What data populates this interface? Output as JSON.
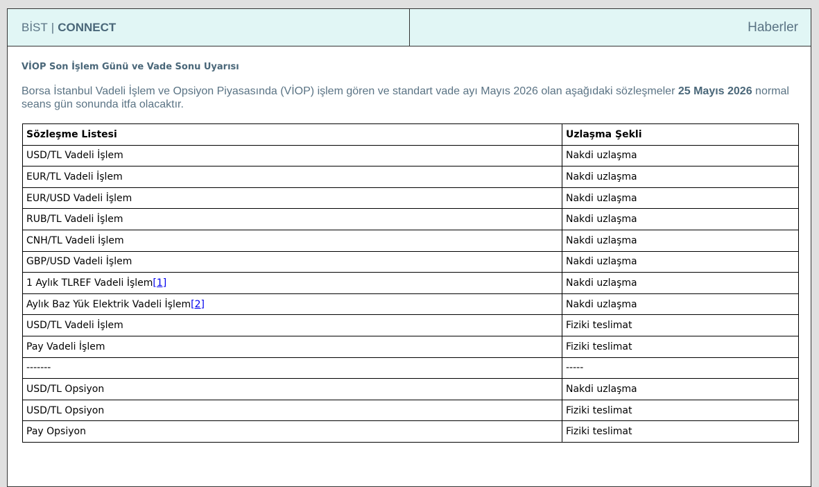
{
  "header": {
    "brand_bist": "BİST",
    "brand_separator": "|",
    "brand_connect": "CONNECT",
    "news_link": "Haberler"
  },
  "notice": {
    "title": "VİOP Son İşlem Günü ve Vade Sonu Uyarısı",
    "body_before": "Borsa İstanbul Vadeli İşlem ve Opsiyon Piyasasında (VİOP) işlem gören ve standart vade ayı Mayıs 2026 olan aşağıdaki sözleşmeler ",
    "body_date": "25 Mayıs 2026",
    "body_after": " normal seans gün sonunda itfa olacaktır."
  },
  "table": {
    "headers": [
      "Sözleşme Listesi",
      "Uzlaşma Şekli"
    ],
    "rows": [
      {
        "contract": "USD/TL Vadeli İşlem",
        "footnote": "",
        "settlement": "Nakdi uzlaşma"
      },
      {
        "contract": "EUR/TL Vadeli İşlem",
        "footnote": "",
        "settlement": "Nakdi uzlaşma"
      },
      {
        "contract": "EUR/USD Vadeli İşlem",
        "footnote": "",
        "settlement": "Nakdi uzlaşma"
      },
      {
        "contract": "RUB/TL Vadeli İşlem",
        "footnote": "",
        "settlement": "Nakdi uzlaşma"
      },
      {
        "contract": "CNH/TL Vadeli İşlem",
        "footnote": "",
        "settlement": "Nakdi uzlaşma"
      },
      {
        "contract": "GBP/USD Vadeli İşlem",
        "footnote": "",
        "settlement": "Nakdi uzlaşma"
      },
      {
        "contract": "1 Aylık TLREF Vadeli İşlem",
        "footnote": "[1]",
        "settlement": "Nakdi uzlaşma"
      },
      {
        "contract": "Aylık Baz Yük Elektrik Vadeli İşlem",
        "footnote": "[2]",
        "settlement": "Nakdi uzlaşma"
      },
      {
        "contract": "USD/TL Vadeli İşlem",
        "footnote": "",
        "settlement": "Fiziki teslimat"
      },
      {
        "contract": "Pay Vadeli İşlem",
        "footnote": "",
        "settlement": "Fiziki teslimat"
      },
      {
        "contract": "-------",
        "footnote": "",
        "settlement": "-----"
      },
      {
        "contract": "USD/TL Opsiyon",
        "footnote": "",
        "settlement": "Nakdi uzlaşma"
      },
      {
        "contract": "USD/TL Opsiyon",
        "footnote": "",
        "settlement": "Fiziki teslimat"
      },
      {
        "contract": "Pay Opsiyon",
        "footnote": "",
        "settlement": "Fiziki teslimat"
      }
    ]
  },
  "colors": {
    "header_bg": "#e1f6f5",
    "header_text": "#5a7384",
    "link": "#0000ee"
  }
}
